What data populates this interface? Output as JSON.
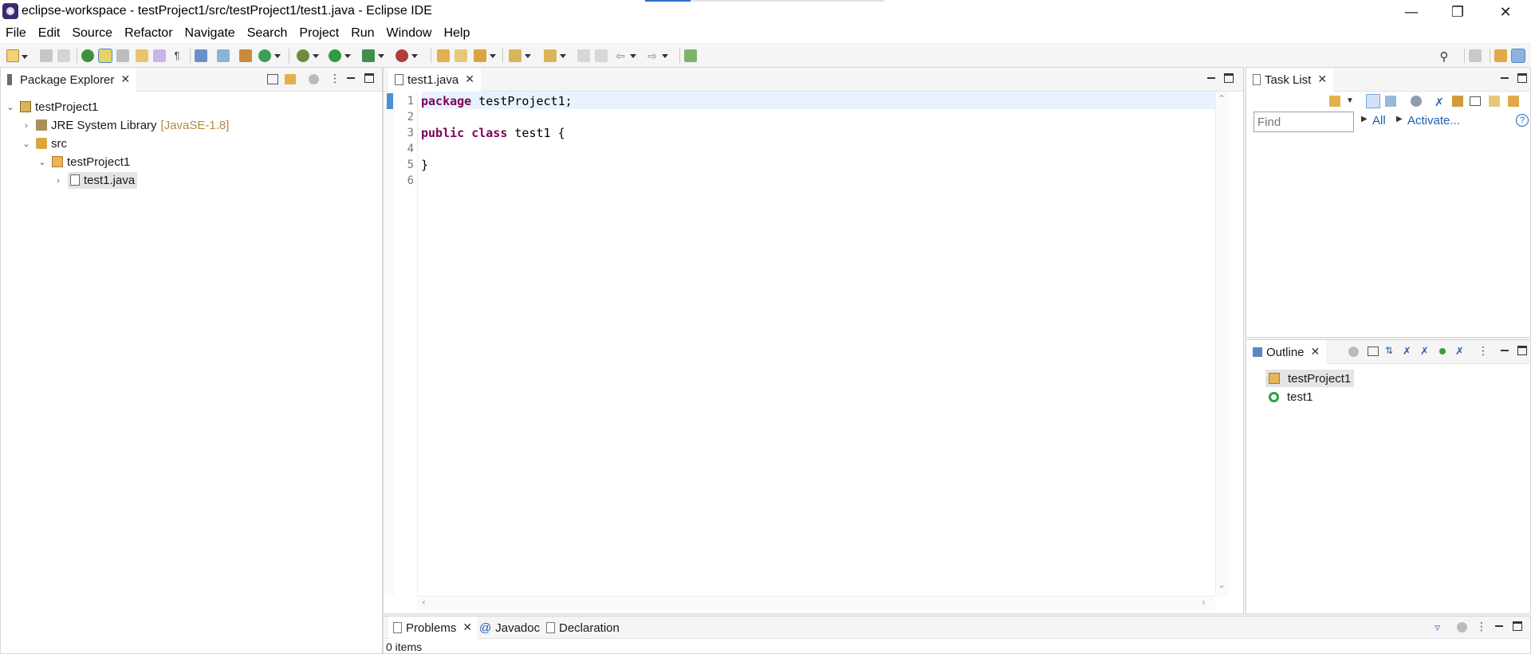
{
  "window": {
    "title": "eclipse-workspace - testProject1/src/testProject1/test1.java - Eclipse IDE",
    "progress": 0.19
  },
  "menu": [
    "File",
    "Edit",
    "Source",
    "Refactor",
    "Navigate",
    "Search",
    "Project",
    "Run",
    "Window",
    "Help"
  ],
  "package_explorer": {
    "tab": "Package Explorer",
    "tree": [
      {
        "label": "testProject1",
        "expanded": true
      },
      {
        "label": "JRE System Library",
        "suffix": "[JavaSE-1.8]",
        "expanded": false
      },
      {
        "label": "src",
        "expanded": true
      },
      {
        "label": "testProject1",
        "expanded": true
      },
      {
        "label": "test1.java",
        "expanded": false,
        "selected": true
      }
    ]
  },
  "editor": {
    "tab": "test1.java",
    "line_numbers": [
      "1",
      "2",
      "3",
      "4",
      "5",
      "6"
    ],
    "lines": [
      {
        "kw": "package",
        "rest": " testProject1;"
      },
      {
        "kw": "",
        "rest": ""
      },
      {
        "kw": "public class",
        "rest": " test1 {"
      },
      {
        "kw": "",
        "rest": ""
      },
      {
        "kw": "",
        "rest": "}"
      },
      {
        "kw": "",
        "rest": ""
      }
    ]
  },
  "task_list": {
    "tab": "Task List",
    "find_placeholder": "Find",
    "all_label": "All",
    "activate_label": "Activate...",
    "help_glyph": "?"
  },
  "outline": {
    "tab": "Outline",
    "items": [
      {
        "label": "testProject1",
        "kind": "package"
      },
      {
        "label": "test1",
        "kind": "class"
      }
    ]
  },
  "bottom": {
    "tabs": [
      "Problems",
      "Javadoc",
      "Declaration"
    ],
    "status": "0 items"
  },
  "colors": {
    "keyword": "#7f0055",
    "selection": "#e4e4e4",
    "current_line": "#e8f2fe",
    "link": "#1a5fb4"
  }
}
